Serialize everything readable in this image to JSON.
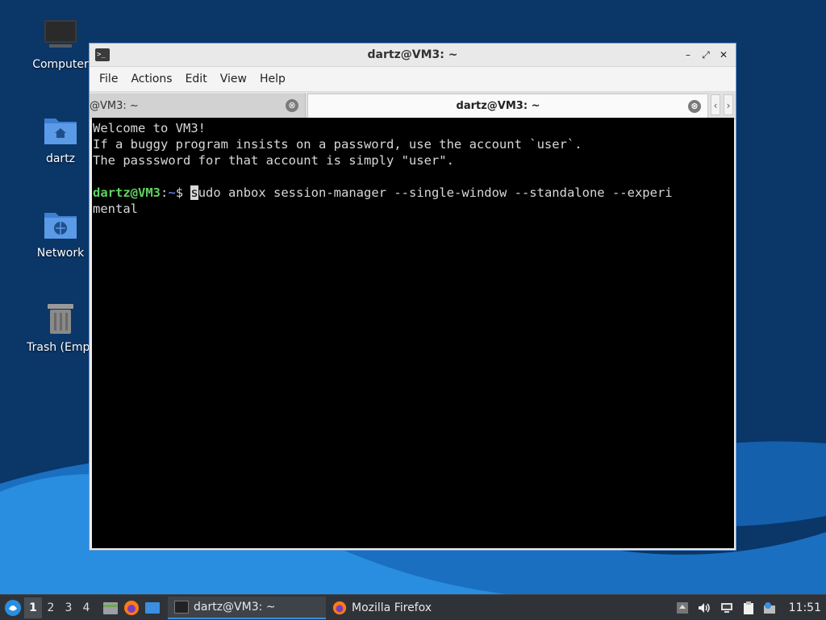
{
  "desktop": {
    "icons": [
      {
        "label": "Computer"
      },
      {
        "label": "dartz"
      },
      {
        "label": "Network"
      },
      {
        "label": "Trash (Empt"
      }
    ]
  },
  "window": {
    "title": "dartz@VM3: ~",
    "app_icon_glyph": ">_",
    "controls": {
      "minimize": "–",
      "maximize": "⤢",
      "close": "✕"
    },
    "menu": [
      "File",
      "Actions",
      "Edit",
      "View",
      "Help"
    ],
    "tabs": [
      {
        "label": "@VM3: ~",
        "close": "⊗"
      },
      {
        "label": "dartz@VM3: ~",
        "close": "⊗"
      }
    ],
    "tab_scroll": {
      "left": "‹",
      "right": "›"
    }
  },
  "terminal": {
    "lines": [
      "Welcome to VM3!",
      "If a buggy program insists on a password, use the account `user`.",
      "The passsword for that account is simply \"user\"."
    ],
    "prompt_user": "dartz@VM3",
    "prompt_sep": ":",
    "prompt_path": "~",
    "prompt_symbol": "$ ",
    "command_cursor_char": "s",
    "command_rest": "udo anbox session-manager --single-window --standalone --experi",
    "command_wrap": "mental"
  },
  "taskbar": {
    "workspaces": [
      "1",
      "2",
      "3",
      "4"
    ],
    "apps": [
      {
        "label": "dartz@VM3: ~",
        "icon": "terminal-icon"
      },
      {
        "label": "Mozilla Firefox",
        "icon": "firefox-icon"
      }
    ],
    "clock": "11:51"
  },
  "colors": {
    "prompt_user": "#5fd35f",
    "prompt_path": "#5b7cd6",
    "taskbar": "#2f3338",
    "terminal_bg": "#000000"
  }
}
